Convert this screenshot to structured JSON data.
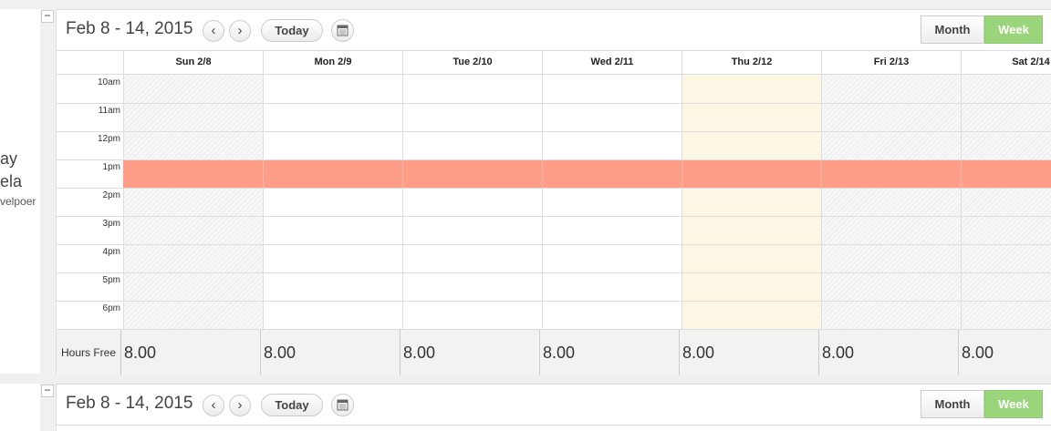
{
  "collapse_label": "−",
  "user": {
    "name_line1": "ay",
    "name_line2": "ela",
    "role": "velpoer"
  },
  "calendar": {
    "range_title": "Feb 8 - 14, 2015",
    "prev_label": "‹",
    "next_label": "›",
    "today_label": "Today",
    "views": {
      "month": "Month",
      "week": "Week"
    },
    "selected_view": "Week",
    "days": [
      "Sun 2/8",
      "Mon 2/9",
      "Tue 2/10",
      "Wed 2/11",
      "Thu 2/12",
      "Fri 2/13",
      "Sat 2/14"
    ],
    "hours": [
      "10am",
      "11am",
      "12pm",
      "1pm",
      "2pm",
      "3pm",
      "4pm",
      "5pm",
      "6pm"
    ],
    "busy_hour": "1pm",
    "weekend_days": [
      "Sun 2/8",
      "Fri 2/13",
      "Sat 2/14"
    ],
    "today_day": "Thu 2/12",
    "footer_label": "Hours Free",
    "hours_free": [
      "8.00",
      "8.00",
      "8.00",
      "8.00",
      "8.00",
      "8.00",
      "8.00"
    ]
  },
  "second_calendar": {
    "range_title": "Feb 8 - 14, 2015",
    "prev_label": "‹",
    "next_label": "›",
    "today_label": "Today",
    "views": {
      "month": "Month",
      "week": "Week"
    }
  },
  "colors": {
    "busy": "#ff9e88",
    "today": "#fcf7e4",
    "active_view": "#9ad57c"
  }
}
